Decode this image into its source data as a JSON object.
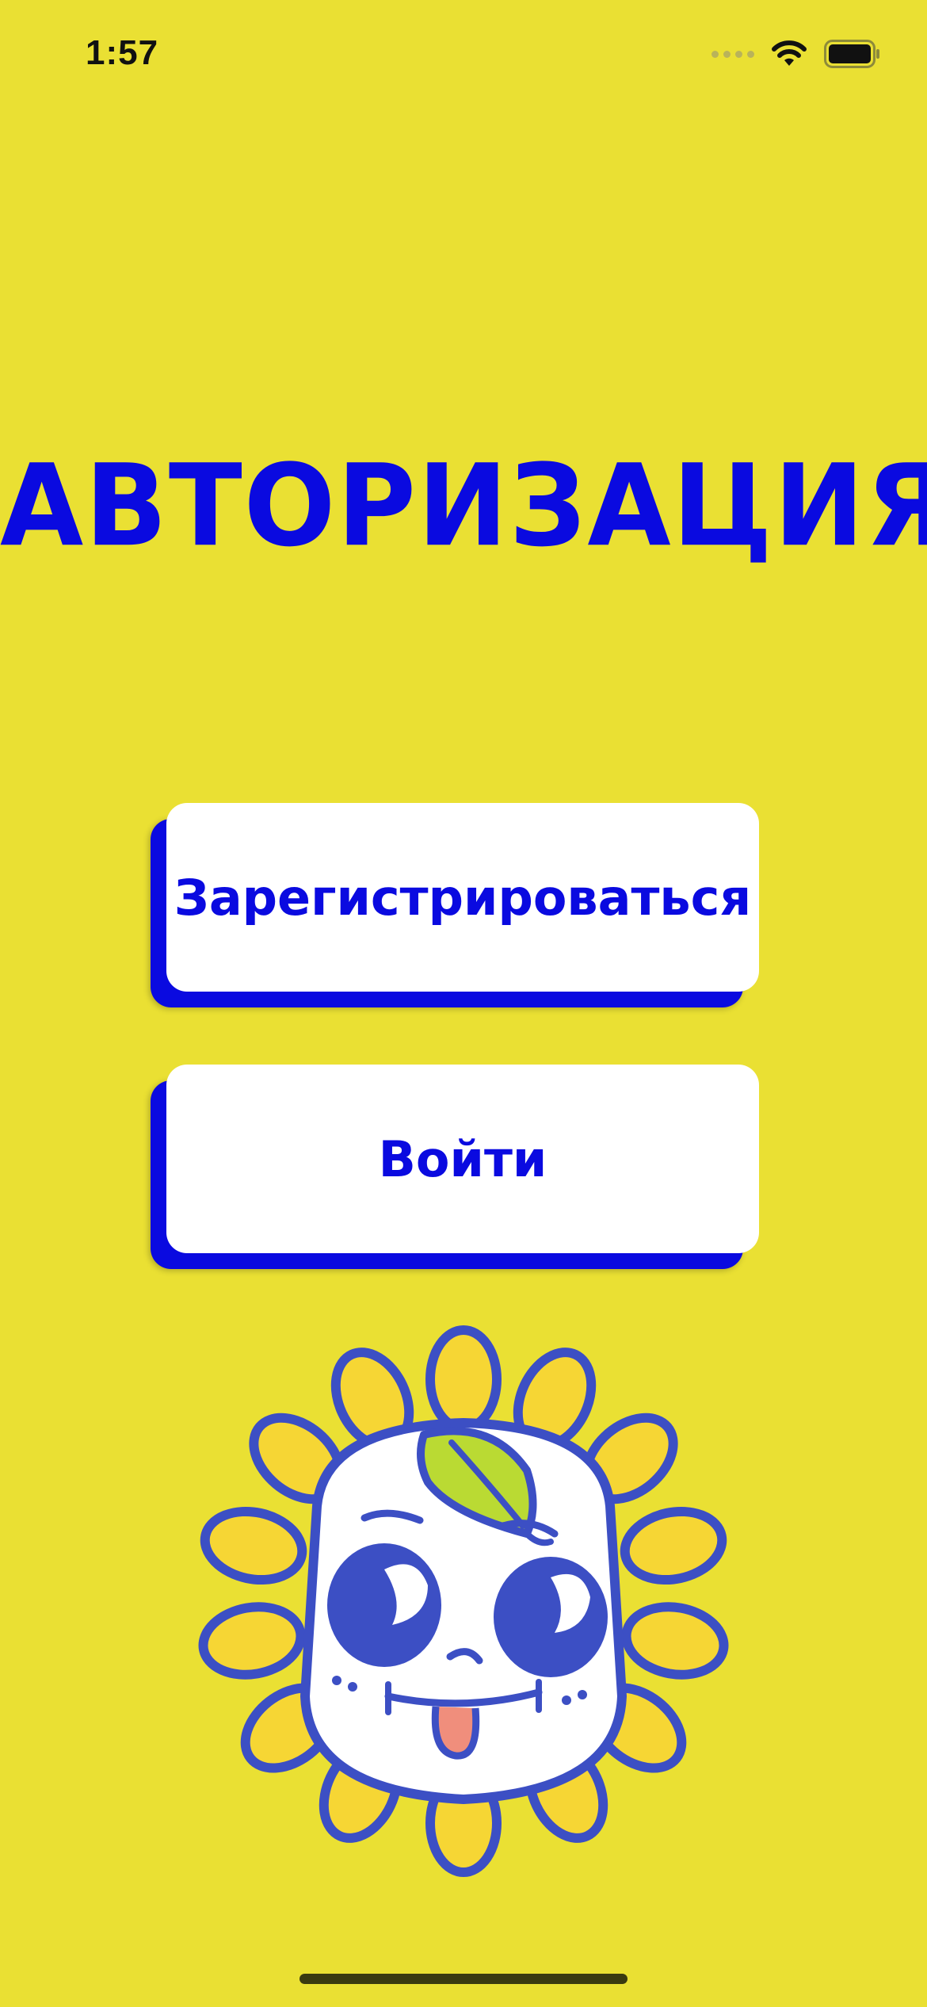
{
  "status_bar": {
    "time": "1:57"
  },
  "screen": {
    "title": "АВТОРИЗАЦИЯ"
  },
  "buttons": {
    "register_label": "Зарегистрироваться",
    "login_label": "Войти"
  },
  "colors": {
    "background": "#EAE033",
    "accent": "#0A0AE0",
    "button_bg": "#FFFFFF"
  },
  "icons": [
    "cellular-signal-icon",
    "wifi-icon",
    "battery-icon",
    "sunflower-mascot-icon"
  ]
}
